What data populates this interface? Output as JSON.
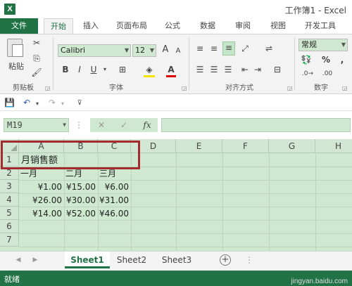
{
  "window": {
    "title": "工作簿1 - Excel"
  },
  "ribbon_tabs": [
    "文件",
    "开始",
    "插入",
    "页面布局",
    "公式",
    "数据",
    "审阅",
    "视图",
    "开发工具"
  ],
  "ribbon": {
    "clipboard": {
      "paste_label": "粘贴",
      "group_label": "剪贴板"
    },
    "font": {
      "name": "Calibri",
      "size": "12",
      "group_label": "字体",
      "bold": "B",
      "italic": "I",
      "underline": "U",
      "grow": "A",
      "shrink": "A"
    },
    "alignment": {
      "group_label": "对齐方式"
    },
    "number": {
      "format": "常规",
      "group_label": "数字",
      "percent": "%",
      "comma": ","
    }
  },
  "formula_bar": {
    "name_box": "M19",
    "fx": "fx",
    "formula": ""
  },
  "grid": {
    "columns": [
      "A",
      "B",
      "C",
      "D",
      "E",
      "F",
      "G",
      "H"
    ],
    "rows": [
      "1",
      "2",
      "3",
      "4",
      "5",
      "6",
      "7"
    ],
    "cells": {
      "A1": "月销售额",
      "A2": "一月",
      "B2": "二月",
      "C2": "三月",
      "A3": "¥1.00",
      "B3": "¥15.00",
      "C3": "¥6.00",
      "A4": "¥26.00",
      "B4": "¥30.00",
      "C4": "¥31.00",
      "A5": "¥14.00",
      "B5": "¥52.00",
      "C5": "¥46.00"
    }
  },
  "sheets": {
    "tabs": [
      "Sheet1",
      "Sheet2",
      "Sheet3"
    ],
    "active": "Sheet1",
    "add": "+"
  },
  "status": {
    "text": "就绪"
  },
  "colors": {
    "accent": "#217346",
    "highlight_box": "#a32b30",
    "cell_fill": "#cfe9d0"
  },
  "watermark": "jingyan.baidu.com"
}
